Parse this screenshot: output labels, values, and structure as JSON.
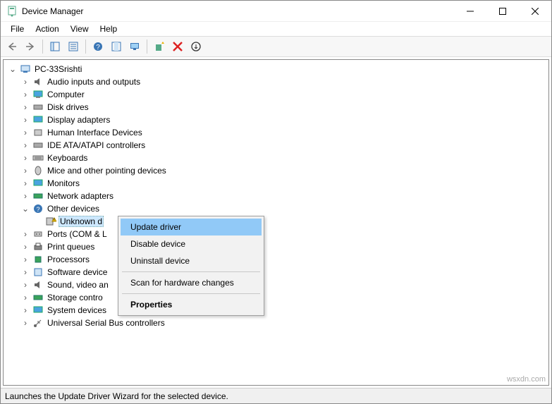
{
  "window": {
    "title": "Device Manager"
  },
  "menu": {
    "file": "File",
    "action": "Action",
    "view": "View",
    "help": "Help"
  },
  "tree": {
    "root": "PC-33Srishti",
    "items": [
      "Audio inputs and outputs",
      "Computer",
      "Disk drives",
      "Display adapters",
      "Human Interface Devices",
      "IDE ATA/ATAPI controllers",
      "Keyboards",
      "Mice and other pointing devices",
      "Monitors",
      "Network adapters",
      "Other devices",
      "Ports (COM & LPT)",
      "Print queues",
      "Processors",
      "Software devices",
      "Sound, video and game controllers",
      "Storage controllers",
      "System devices",
      "Universal Serial Bus controllers"
    ],
    "other_child": "Unknown device",
    "other_child_truncated": "Unknown d",
    "ports_truncated": "Ports (COM & L",
    "software_truncated": "Software device",
    "sound_truncated": "Sound, video an",
    "storage_truncated": "Storage contro"
  },
  "context": {
    "update": "Update driver",
    "disable": "Disable device",
    "uninstall": "Uninstall device",
    "scan": "Scan for hardware changes",
    "properties": "Properties"
  },
  "status": "Launches the Update Driver Wizard for the selected device.",
  "watermark": "wsxdn.com"
}
